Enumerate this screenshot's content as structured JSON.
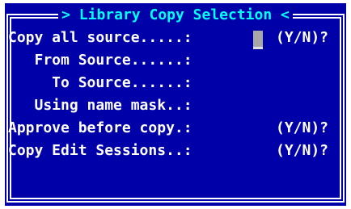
{
  "dialog": {
    "title": "> Library Copy Selection <"
  },
  "fields": [
    {
      "label": "Copy all source.....:",
      "value": "",
      "hint": "(Y/N)?"
    },
    {
      "label": "   From Source......:",
      "value": "",
      "hint": ""
    },
    {
      "label": "     To Source......:",
      "value": "",
      "hint": ""
    },
    {
      "label": "   Using name mask..:",
      "value": "",
      "hint": ""
    },
    {
      "label": "Approve before copy.:",
      "value": "",
      "hint": "(Y/N)?"
    },
    {
      "label": "Copy Edit Sessions..:",
      "value": "",
      "hint": "(Y/N)?"
    }
  ],
  "colors": {
    "background": "#0000a8",
    "title": "#00ffff",
    "text": "#ffffff",
    "cursor": "#a8a8a8"
  }
}
